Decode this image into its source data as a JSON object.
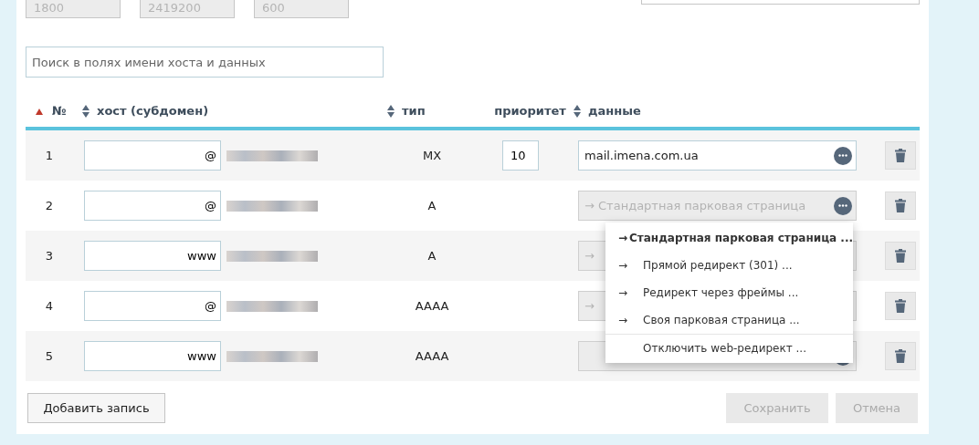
{
  "top_fields": [
    {
      "value": "1800",
      "disabled": true
    },
    {
      "value": "2419200",
      "disabled": true
    },
    {
      "value": "600",
      "disabled": true
    }
  ],
  "search": {
    "placeholder": "Поиск в полях имени хоста и данных"
  },
  "table": {
    "columns": [
      {
        "label": "№",
        "sortable": true,
        "sorted": true
      },
      {
        "label": "хост (субдомен)",
        "sortable": true,
        "sorted": false
      },
      {
        "label": "тип",
        "sortable": true,
        "sorted": false
      },
      {
        "label": "приоритет",
        "sortable": false
      },
      {
        "label": "данные",
        "sortable": true,
        "sorted": false
      }
    ],
    "rows": [
      {
        "number": "1",
        "host": "@",
        "type": "MX",
        "priority": "10",
        "data": "mail.imena.com.ua",
        "data_disabled": false
      },
      {
        "number": "2",
        "host": "@",
        "type": "A",
        "data": "→ Стандартная парковая страница",
        "data_disabled": true,
        "menu_open": true
      },
      {
        "number": "3",
        "host": "www",
        "type": "A",
        "data": "→",
        "data_disabled": true
      },
      {
        "number": "4",
        "host": "@",
        "type": "AAAA",
        "data": "→",
        "data_disabled": true
      },
      {
        "number": "5",
        "host": "www",
        "type": "AAAA",
        "data_disabled": true
      }
    ]
  },
  "menu": {
    "items": [
      {
        "arrow": "→",
        "label": "Стандартная парковая страница ...",
        "selected": true
      },
      {
        "arrow": "→",
        "label": "Прямой редирект (301) ...",
        "selected": false
      },
      {
        "arrow": "→",
        "label": "Редирект через фреймы ...",
        "selected": false
      },
      {
        "arrow": "→",
        "label": "Своя парковая страница ...",
        "selected": false
      },
      {
        "label": "Отключить web-редирект ...",
        "selected": false,
        "separator": true
      }
    ]
  },
  "buttons": [
    {
      "label": "Добавить запись",
      "disabled": false
    },
    {
      "label": "Сохранить",
      "disabled": true
    },
    {
      "label": "Отмена",
      "disabled": true
    }
  ]
}
